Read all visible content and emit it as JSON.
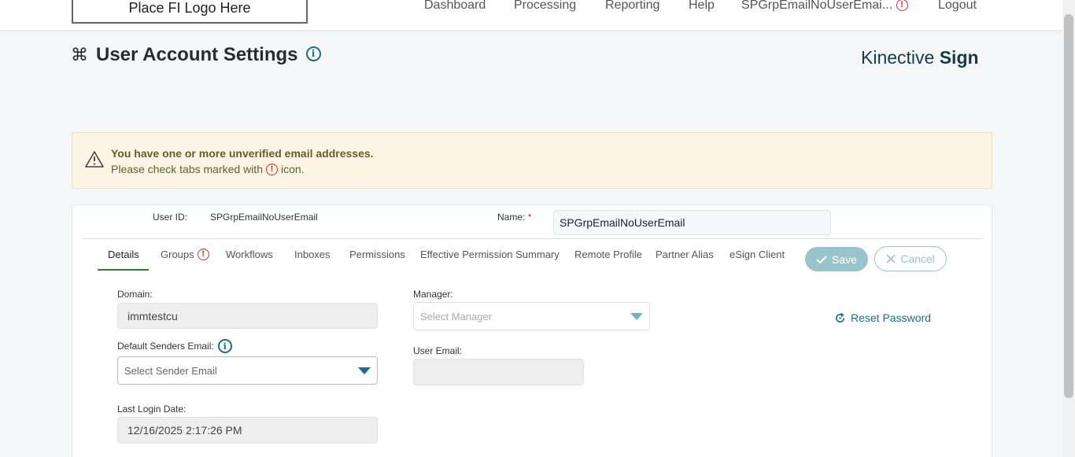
{
  "header": {
    "logo_placeholder": "Place FI Logo Here",
    "nav": {
      "dashboard": "Dashboard",
      "processing": "Processing",
      "reporting": "Reporting",
      "help": "Help",
      "user": "SPGrpEmailNoUserEmai...",
      "logout": "Logout"
    }
  },
  "page": {
    "title": "User Account Settings",
    "brand_light": "Kinective ",
    "brand_bold": "Sign"
  },
  "alert": {
    "title": "You have one or more unverified email addresses.",
    "message_prefix": "Please check tabs marked with",
    "message_suffix": "icon."
  },
  "user_header": {
    "user_id_label": "User ID:",
    "user_id_value": "SPGrpEmailNoUserEmail",
    "name_label": "Name:",
    "name_required": "*",
    "name_value": "SPGrpEmailNoUserEmail"
  },
  "tabs": [
    {
      "label": "Details",
      "active": true
    },
    {
      "label": "Groups",
      "warning": true
    },
    {
      "label": "Workflows"
    },
    {
      "label": "Inboxes"
    },
    {
      "label": "Permissions"
    },
    {
      "label": "Effective Permission Summary"
    },
    {
      "label": "Remote Profile"
    },
    {
      "label": "Partner Alias"
    },
    {
      "label": "eSign Client"
    }
  ],
  "actions": {
    "save": "Save",
    "cancel": "Cancel"
  },
  "form": {
    "domain_label": "Domain:",
    "domain_value": "immtestcu",
    "default_senders_label": "Default Senders Email:",
    "default_senders_placeholder": "Select Sender Email",
    "last_login_label": "Last Login Date:",
    "last_login_value": "12/16/2025 2:17:26 PM",
    "manager_label": "Manager:",
    "manager_placeholder": "Select Manager",
    "user_email_label": "User Email:",
    "user_email_value": "",
    "reset_password": "Reset Password"
  },
  "colors": {
    "accent": "#1b6f86",
    "warning": "#d32f2f",
    "alert_bg": "#fcf5e3",
    "active_tab": "#2e7d32"
  }
}
